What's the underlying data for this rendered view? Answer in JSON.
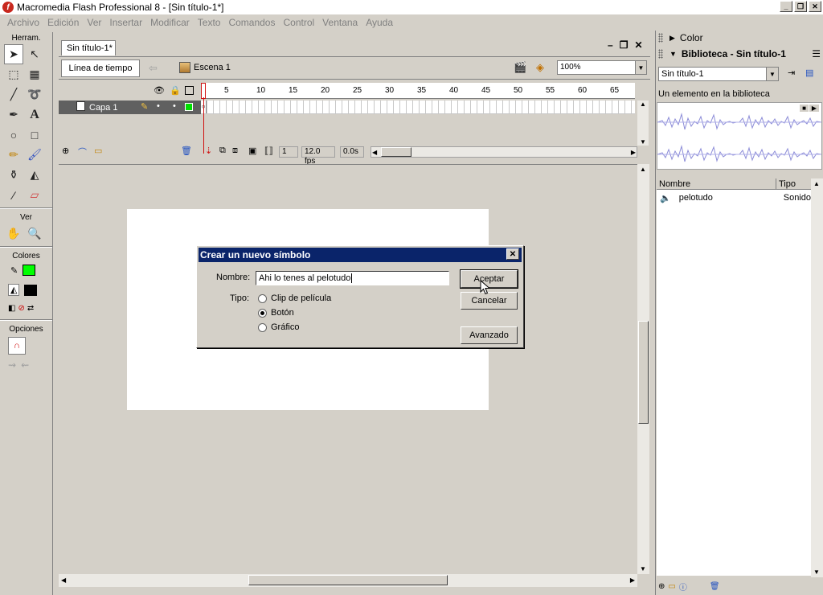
{
  "window": {
    "title": "Macromedia Flash Professional 8 - [Sin título-1*]",
    "icon_label": "f"
  },
  "menu": [
    "Archivo",
    "Edición",
    "Ver",
    "Insertar",
    "Modificar",
    "Texto",
    "Comandos",
    "Control",
    "Ventana",
    "Ayuda"
  ],
  "tools": {
    "heading": "Herram.",
    "view_heading": "Ver",
    "colors_heading": "Colores",
    "options_heading": "Opciones",
    "stroke_color": "#000000",
    "fill_color": "#00ff00"
  },
  "document": {
    "tab_label": "Sin título-1*",
    "timeline_button": "Línea de tiempo",
    "scene_label": "Escena 1",
    "zoom": "100%"
  },
  "timeline": {
    "layer_name": "Capa 1",
    "ruler_numbers": [
      "1",
      "5",
      "10",
      "15",
      "20",
      "25",
      "30",
      "35",
      "40",
      "45",
      "50",
      "55",
      "60",
      "65"
    ],
    "current_frame": "1",
    "fps": "12.0 fps",
    "elapsed": "0.0s"
  },
  "dialog": {
    "title": "Crear un nuevo símbolo",
    "name_label": "Nombre:",
    "name_value": "Ahi lo tenes al pelotudo",
    "type_label": "Tipo:",
    "options": [
      "Clip de película",
      "Botón",
      "Gráfico"
    ],
    "selected_option": "Botón",
    "ok_label": "Aceptar",
    "cancel_label": "Cancelar",
    "advanced_label": "Avanzado"
  },
  "panels": {
    "color_title": "Color",
    "library_title": "Biblioteca - Sin título-1",
    "library_select": "Sin título-1",
    "library_count": "Un elemento en la biblioteca",
    "col_name": "Nombre",
    "col_type": "Tipo",
    "items": [
      {
        "name": "pelotudo",
        "type": "Sonido"
      }
    ]
  }
}
